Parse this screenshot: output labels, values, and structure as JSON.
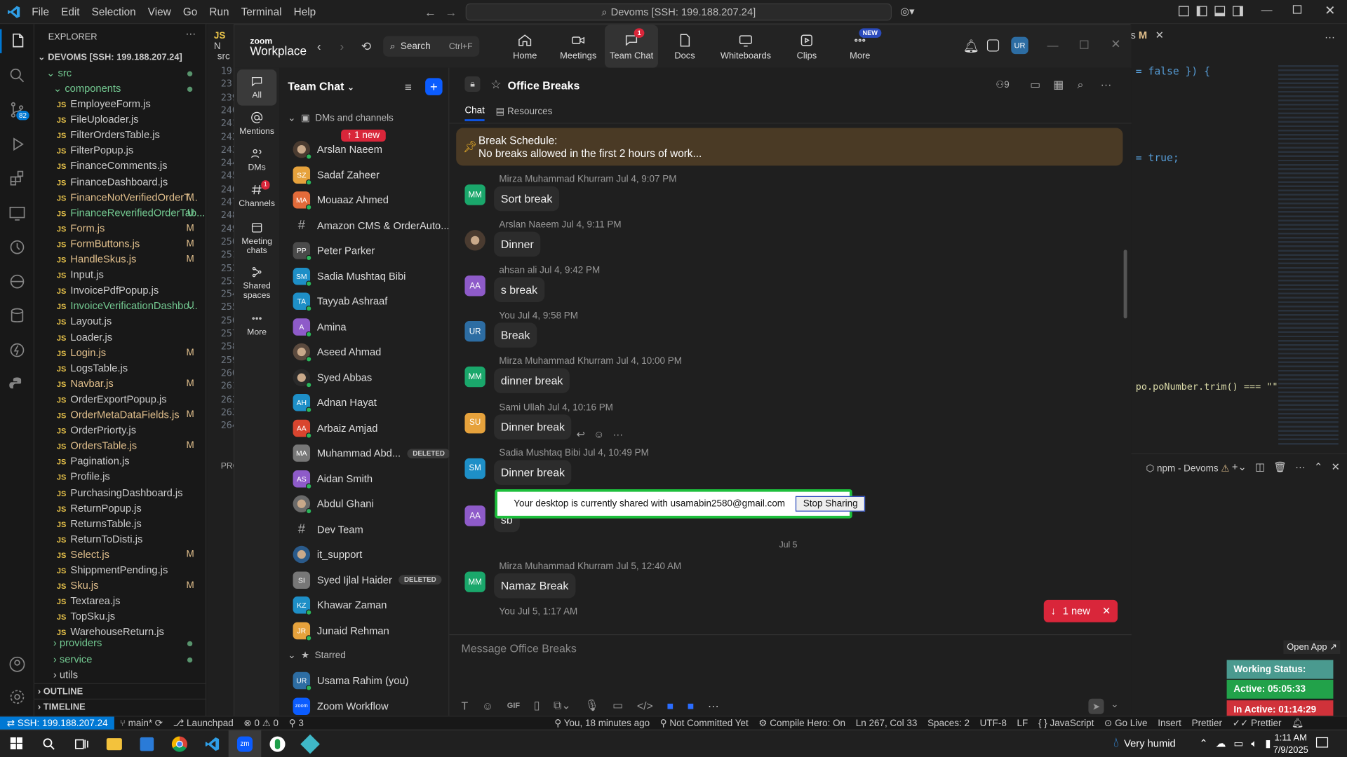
{
  "vscode": {
    "menu": [
      "File",
      "Edit",
      "Selection",
      "View",
      "Go",
      "Run",
      "Terminal",
      "Help"
    ],
    "command_center": "Devoms [SSH: 199.188.207.24]",
    "explorer_title": "EXPLORER",
    "workspace": "DEVOMS [SSH: 199.188.207.24]",
    "folders": {
      "src": "src",
      "components": "components",
      "providers": "providers",
      "service": "service",
      "utils": "utils"
    },
    "files": [
      {
        "name": "EmployeeForm.js",
        "status": "",
        "color": "#cccccc"
      },
      {
        "name": "FileUploader.js",
        "status": "",
        "color": "#cccccc"
      },
      {
        "name": "FilterOrdersTable.js",
        "status": "",
        "color": "#cccccc"
      },
      {
        "name": "FilterPopup.js",
        "status": "",
        "color": "#cccccc"
      },
      {
        "name": "FinanceComments.js",
        "status": "",
        "color": "#cccccc"
      },
      {
        "name": "FinanceDashboard.js",
        "status": "",
        "color": "#cccccc"
      },
      {
        "name": "FinanceNotVerifiedOrderT...",
        "status": "M",
        "color": "#e2c08d"
      },
      {
        "name": "FinanceReverifiedOrderTab...",
        "status": "U",
        "color": "#73c991"
      },
      {
        "name": "Form.js",
        "status": "M",
        "color": "#e2c08d"
      },
      {
        "name": "FormButtons.js",
        "status": "M",
        "color": "#e2c08d"
      },
      {
        "name": "HandleSkus.js",
        "status": "M",
        "color": "#e2c08d"
      },
      {
        "name": "Input.js",
        "status": "",
        "color": "#cccccc"
      },
      {
        "name": "InvoicePdfPopup.js",
        "status": "",
        "color": "#cccccc"
      },
      {
        "name": "InvoiceVerificationDashbo...",
        "status": "U",
        "color": "#73c991"
      },
      {
        "name": "Layout.js",
        "status": "",
        "color": "#cccccc"
      },
      {
        "name": "Loader.js",
        "status": "",
        "color": "#cccccc"
      },
      {
        "name": "Login.js",
        "status": "M",
        "color": "#e2c08d"
      },
      {
        "name": "LogsTable.js",
        "status": "",
        "color": "#cccccc"
      },
      {
        "name": "Navbar.js",
        "status": "M",
        "color": "#e2c08d"
      },
      {
        "name": "OrderExportPopup.js",
        "status": "",
        "color": "#cccccc"
      },
      {
        "name": "OrderMetaDataFields.js",
        "status": "M",
        "color": "#e2c08d"
      },
      {
        "name": "OrderPriorty.js",
        "status": "",
        "color": "#cccccc"
      },
      {
        "name": "OrdersTable.js",
        "status": "M",
        "color": "#e2c08d"
      },
      {
        "name": "Pagination.js",
        "status": "",
        "color": "#cccccc"
      },
      {
        "name": "Profile.js",
        "status": "",
        "color": "#cccccc"
      },
      {
        "name": "PurchasingDashboard.js",
        "status": "",
        "color": "#cccccc"
      },
      {
        "name": "ReturnPopup.js",
        "status": "",
        "color": "#cccccc"
      },
      {
        "name": "ReturnsTable.js",
        "status": "",
        "color": "#cccccc"
      },
      {
        "name": "ReturnToDisti.js",
        "status": "",
        "color": "#cccccc"
      },
      {
        "name": "Select.js",
        "status": "M",
        "color": "#e2c08d"
      },
      {
        "name": "ShippmentPending.js",
        "status": "",
        "color": "#cccccc"
      },
      {
        "name": "Sku.js",
        "status": "M",
        "color": "#e2c08d"
      },
      {
        "name": "Textarea.js",
        "status": "",
        "color": "#cccccc"
      },
      {
        "name": "TopSku.js",
        "status": "",
        "color": "#cccccc"
      },
      {
        "name": "WarehouseReturn.js",
        "status": "",
        "color": "#cccccc"
      }
    ],
    "outline": "OUTLINE",
    "timeline": "TIMELINE",
    "line_numbers": [
      "19",
      "23",
      "239",
      "240",
      "241",
      "242",
      "243",
      "244",
      "245",
      "246",
      "247",
      "248",
      "249",
      "250",
      "251",
      "252",
      "253",
      "254",
      "255",
      "256",
      "257",
      "258",
      "259",
      "260",
      "261",
      "262",
      "263",
      "264"
    ],
    "tab_partial": "N",
    "src_partial": "src",
    "pro_partial": "PRO",
    "code": {
      "line1": "= false }) {",
      "line2": "= true;",
      "line3": "po.poNumber.trim() === \"\""
    },
    "tab_right": "s",
    "tab_right_m": "M",
    "terminal": {
      "label": "npm - Devoms"
    },
    "explorer_badge": "82",
    "status": {
      "remote": "SSH: 199.188.207.24",
      "branch": "main*",
      "launchpad": "Launchpad",
      "problems": "0 ⚠ 0",
      "ports": "3",
      "blame": "You, 18 minutes ago",
      "commit": "Not Committed Yet",
      "compile": "Compile Hero: On",
      "pos": "Ln 267, Col 33",
      "spaces": "Spaces: 2",
      "enc": "UTF-8",
      "eol": "LF",
      "lang": "JavaScript",
      "golive": "Go Live",
      "insert": "Insert",
      "prettier1": "Prettier",
      "prettier2": "Prettier"
    }
  },
  "zoom": {
    "logo_top": "zoom",
    "logo_bottom": "Workplace",
    "search": "Search",
    "search_shortcut": "Ctrl+F",
    "nav": [
      {
        "label": "Home",
        "icon": "home-icon"
      },
      {
        "label": "Meetings",
        "icon": "video-icon"
      },
      {
        "label": "Team Chat",
        "icon": "chat-icon",
        "badge": "1"
      },
      {
        "label": "Docs",
        "icon": "doc-icon"
      },
      {
        "label": "Whiteboards",
        "icon": "whiteboard-icon"
      },
      {
        "label": "Clips",
        "icon": "clips-icon"
      },
      {
        "label": "More",
        "icon": "more-icon",
        "badge": "NEW"
      }
    ],
    "user_initials": "UR",
    "rail": [
      {
        "label": "All",
        "icon": "chat-bubble-icon"
      },
      {
        "label": "Mentions",
        "icon": "at-icon"
      },
      {
        "label": "DMs",
        "icon": "people-icon"
      },
      {
        "label": "Channels",
        "icon": "hash-icon",
        "badge": "1"
      },
      {
        "label": "Meeting chats",
        "icon": "calendar-icon"
      },
      {
        "label": "Shared spaces",
        "icon": "share-icon"
      },
      {
        "label": "More",
        "icon": "ellipsis-icon"
      }
    ],
    "list_title": "Team Chat",
    "section_dms": "DMs and channels",
    "new_pill": "↑ 1 new",
    "contacts": [
      {
        "name": "Arslan Naeem",
        "init": "",
        "color": "#4a3b30",
        "photo": true,
        "online": true
      },
      {
        "name": "Sadaf Zaheer",
        "init": "SZ",
        "color": "#e6a23c",
        "online": true
      },
      {
        "name": "Mouaaz Ahmed",
        "init": "MA",
        "color": "#e26b3a",
        "online": true
      },
      {
        "name": "Amazon CMS & OrderAuto...",
        "init": "#",
        "color": "",
        "channel": true
      },
      {
        "name": "Peter Parker",
        "init": "PP",
        "color": "#4a4a4a",
        "online": true
      },
      {
        "name": "Sadia Mushtaq Bibi",
        "init": "SM",
        "color": "#1e8fc7",
        "online": true
      },
      {
        "name": "Tayyab Ashraaf",
        "init": "TA",
        "color": "#1e8fc7",
        "online": true
      },
      {
        "name": "Amina",
        "init": "A",
        "color": "#8e5bc9",
        "online": true
      },
      {
        "name": "Aseed Ahmad",
        "init": "",
        "color": "#5b4a3e",
        "photo": true,
        "online": true
      },
      {
        "name": "Syed Abbas",
        "init": "",
        "color": "#2a2a2a",
        "photo": true,
        "online": true
      },
      {
        "name": "Adnan Hayat",
        "init": "AH",
        "color": "#1e8fc7",
        "online": true
      },
      {
        "name": "Arbaiz Amjad",
        "init": "AA",
        "color": "#d9452f",
        "online": true
      },
      {
        "name": "Muhammad Abd...",
        "init": "MA",
        "color": "#777777",
        "deleted": "DELETED"
      },
      {
        "name": "Aidan Smith",
        "init": "AS",
        "color": "#8e5bc9",
        "online": true
      },
      {
        "name": "Abdul Ghani",
        "init": "",
        "color": "#6a6a6a",
        "photo": true,
        "online": true
      },
      {
        "name": "Dev Team",
        "init": "#",
        "color": "",
        "channel": true
      },
      {
        "name": "it_support",
        "init": "",
        "color": "#2a5a8a",
        "photo": true
      },
      {
        "name": "Syed Ijlal Haider",
        "init": "SI",
        "color": "#777777",
        "deleted": "DELETED"
      },
      {
        "name": "Khawar Zaman",
        "init": "KZ",
        "color": "#1e8fc7",
        "online": true
      },
      {
        "name": "Junaid Rehman",
        "init": "JR",
        "color": "#e6a23c",
        "online": true
      }
    ],
    "starred_label": "Starred",
    "starred": [
      {
        "name": "Usama Rahim (you)",
        "init": "UR",
        "color": "#2d6da3",
        "online": true
      },
      {
        "name": "Zoom Workflow",
        "init": "zoom",
        "color": "#0b5cff"
      }
    ],
    "chat": {
      "title": "Office Breaks",
      "members": "9",
      "tabs": [
        "Chat",
        "Resources"
      ],
      "pinned_title": "Break Schedule:",
      "pinned_body": "No breaks allowed in the first 2 hours of work...",
      "messages": [
        {
          "author": "Mirza Muhammad Khurram",
          "time": "Jul 4, 9:07 PM",
          "text": "Sort break",
          "init": "MM",
          "color": "#1aa76b"
        },
        {
          "author": "Arslan Naeem",
          "time": "Jul 4, 9:11 PM",
          "text": "Dinner",
          "init": "",
          "color": "#4a3b30"
        },
        {
          "author": "ahsan ali",
          "time": "Jul 4, 9:42 PM",
          "text": "s break",
          "init": "AA",
          "color": "#8e5bc9"
        },
        {
          "author": "You",
          "time": "Jul 4, 9:58 PM",
          "text": "Break",
          "init": "UR",
          "color": "#2d6da3"
        },
        {
          "author": "Mirza Muhammad Khurram",
          "time": "Jul 4, 10:00 PM",
          "text": "dinner break",
          "init": "MM",
          "color": "#1aa76b"
        },
        {
          "author": "Sami Ullah",
          "time": "Jul 4, 10:16 PM",
          "text": "Dinner break",
          "init": "SU",
          "color": "#e6a23c"
        },
        {
          "author": "Sadia Mushtaq Bibi",
          "time": "Jul 4, 10:49 PM",
          "text": "Dinner break",
          "init": "SM",
          "color": "#1e8fc7"
        },
        {
          "author": "",
          "time": "",
          "text": "sb",
          "init": "AA",
          "color": "#8e5bc9"
        }
      ],
      "date_sep": "Jul 5",
      "messages2": [
        {
          "author": "Mirza Muhammad Khurram",
          "time": "Jul 5, 12:40 AM",
          "text": "Namaz Break",
          "init": "MM",
          "color": "#1aa76b"
        },
        {
          "author": "You",
          "time": "Jul 5, 1:17 AM",
          "text": "",
          "init": "",
          "color": ""
        }
      ],
      "new_btn": "1 new",
      "composer_placeholder": "Message Office Breaks"
    },
    "share_banner": {
      "text": "Your desktop is currently shared with usamabin2580@gmail.com",
      "button": "Stop Sharing"
    }
  },
  "widgets": {
    "open_app": "Open App ↗",
    "working": "Working Status: Active",
    "active": "Active: 05:05:33",
    "inactive": "In Active: 01:14:29"
  },
  "taskbar": {
    "weather": "Very humid",
    "time": "1:11 AM",
    "date": "7/9/2025"
  }
}
